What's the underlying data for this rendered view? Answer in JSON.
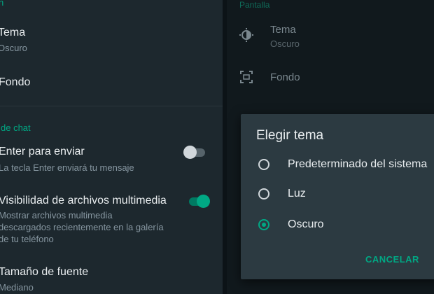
{
  "left": {
    "display_header": "n",
    "theme_title": "Tema",
    "theme_value": "Oscuro",
    "wallpaper_title": "Fondo",
    "chat_settings_header": "de chat",
    "enter_send_title": "Enter para enviar",
    "enter_send_sub": "La tecla Enter enviará tu mensaje",
    "enter_send_on": false,
    "media_visibility_title": "Visibilidad de archivos multimedia",
    "media_visibility_sub": [
      "Mostrar archivos multimedia",
      "descargados recientemente en la galería",
      "de tu teléfono"
    ],
    "media_visibility_on": true,
    "font_size_title": "Tamaño de fuente",
    "font_size_value": "Mediano"
  },
  "right": {
    "header": "Pantalla",
    "theme_title": "Tema",
    "theme_value": "Oscuro",
    "wallpaper_title": "Fondo"
  },
  "dialog": {
    "title": "Elegir tema",
    "options": [
      {
        "label": "Predeterminado del sistema",
        "selected": false
      },
      {
        "label": "Luz",
        "selected": false
      },
      {
        "label": "Oscuro",
        "selected": true
      }
    ],
    "cancel_label": "CANCELAR"
  },
  "colors": {
    "accent": "#00a884",
    "panel_bg": "#1d282e",
    "dialog_bg": "#2c3a41"
  }
}
